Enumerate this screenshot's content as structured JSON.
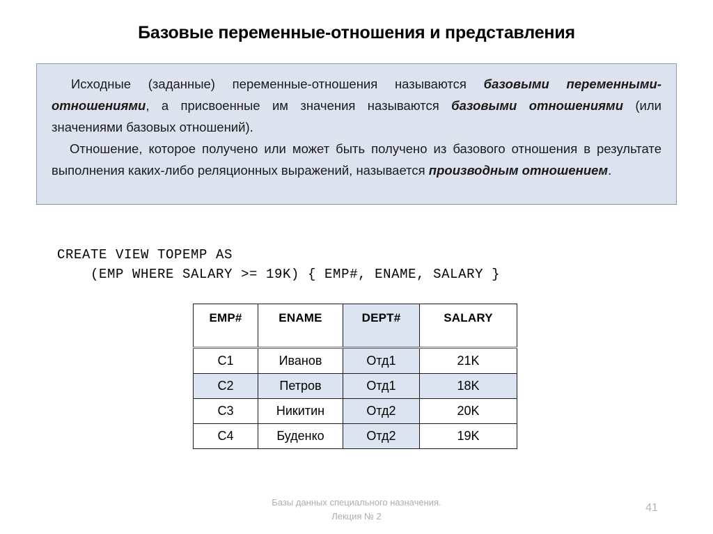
{
  "slide": {
    "title": "Базовые переменные-отношения и представления",
    "page_number": "41"
  },
  "callout": {
    "paragraph1": {
      "part1": "Исходные (заданные) переменные-отношения называются ",
      "em1": "базовыми переменными-отношениями",
      "part2": ", а присвоенные им значения называются ",
      "em2": "базовыми отношениями",
      "part3": " (или значениями базовых отношений)."
    },
    "paragraph2": {
      "part1": "Отношение, которое получено или может быть получено из базового отношения в результате выполнения каких-либо реляционных выражений, называется ",
      "em1": "производным отношением",
      "part2": "."
    }
  },
  "code": {
    "line1": "CREATE VIEW TOPEMP AS",
    "line2": "    (EMP WHERE SALARY >= 19K) { EMP#, ENAME, SALARY }"
  },
  "table": {
    "headers": [
      "EMP#",
      "ENAME",
      "DEPT#",
      "SALARY"
    ],
    "header_highlight": [
      false,
      false,
      true,
      false
    ],
    "rows": [
      {
        "cells": [
          "C1",
          "Иванов",
          "Отд1",
          "21K"
        ],
        "row_highlight": false,
        "cell_highlight": [
          false,
          false,
          true,
          false
        ]
      },
      {
        "cells": [
          "C2",
          "Петров",
          "Отд1",
          "18K"
        ],
        "row_highlight": true,
        "cell_highlight": [
          true,
          true,
          true,
          true
        ]
      },
      {
        "cells": [
          "C3",
          "Никитин",
          "Отд2",
          "20K"
        ],
        "row_highlight": false,
        "cell_highlight": [
          false,
          false,
          true,
          false
        ]
      },
      {
        "cells": [
          "C4",
          "Буденко",
          "Отд2",
          "19K"
        ],
        "row_highlight": false,
        "cell_highlight": [
          false,
          false,
          true,
          false
        ]
      }
    ]
  },
  "footer": {
    "line1": "Базы данных специального назначения.",
    "line2": "Лекция № 2"
  },
  "colors": {
    "callout_background": "#dce3ef",
    "callout_border": "#8c97ab",
    "cell_highlight": "#dbe4f0",
    "table_border": "#1a1a1a",
    "footer_text": "#adadad"
  }
}
